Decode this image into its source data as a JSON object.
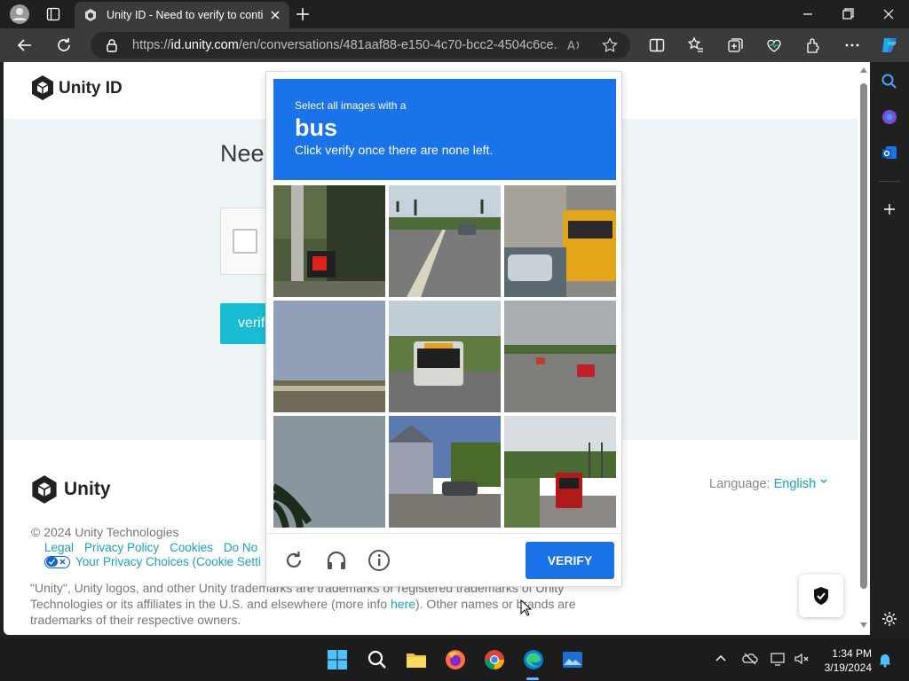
{
  "browser": {
    "tab_title": "Unity ID - Need to verify to conti",
    "url_prefix": "https://",
    "url_domain": "id.unity.com",
    "url_rest": "/en/conversations/481aaf88-e150-4c70-bcc2-4504c6ce...",
    "accent": "#3b3b3b"
  },
  "page": {
    "logo_top": "Unity ID",
    "heading": "Nee",
    "verify_button": "verif",
    "footer_logo": "Unity",
    "copyright": "© 2024 Unity Technologies",
    "links": [
      "Legal",
      "Privacy Policy",
      "Cookies",
      "Do No"
    ],
    "privacy_choices": "Your Privacy Choices (Cookie Setti",
    "disclaimer_pre": "\"Unity\", Unity logos, and other Unity trademarks are trademarks or registered trademarks of Unity Technologies or its affiliates in the U.S. and elsewhere (more info ",
    "disclaimer_link": "here",
    "disclaimer_post": "). Other names or brands are trademarks of their respective owners.",
    "language_label": "Language: ",
    "language_value": "English",
    "link_color": "#19a3bd"
  },
  "hcaptcha": {
    "prompt_line1": "Select all images with a",
    "prompt_target": "bus",
    "prompt_line3": "Click verify once there are none left.",
    "verify_label": "VERIFY",
    "accent": "#1a73e8",
    "tiles": [
      "traffic-signal",
      "highway-road",
      "school-bus",
      "open-field-sky",
      "city-bus",
      "freeway-cars",
      "palm-tree-sky",
      "houses-street",
      "red-bus-road"
    ],
    "icons": [
      "refresh-icon",
      "headphones-icon",
      "info-icon"
    ]
  },
  "taskbar": {
    "time": "1:34 PM",
    "date": "3/19/2024"
  }
}
